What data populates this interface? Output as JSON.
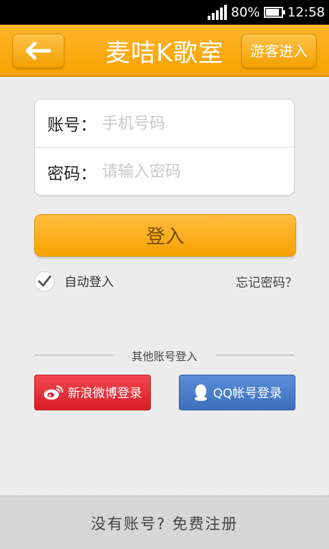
{
  "status_bar": {
    "battery": "80%",
    "time": "12:58"
  },
  "header": {
    "title": "麦咭K歌室",
    "guest_button": "游客进入",
    "back_icon": "arrow-left-icon"
  },
  "form": {
    "account_label": "账号：",
    "account_placeholder": "手机号码",
    "password_label": "密码：",
    "password_placeholder": "请输入密码"
  },
  "login_button": "登入",
  "auto_login": {
    "label": "自动登入",
    "checked": true
  },
  "forgot_password": "忘记密码？",
  "other_login": {
    "title": "其他账号登入",
    "weibo": "新浪微博登录",
    "qq": "QQ帐号登录"
  },
  "register": "没有账号? 免费注册",
  "colors": {
    "header": "#f6a300",
    "weibo": "#d81d26",
    "qq": "#3c6fbd"
  }
}
